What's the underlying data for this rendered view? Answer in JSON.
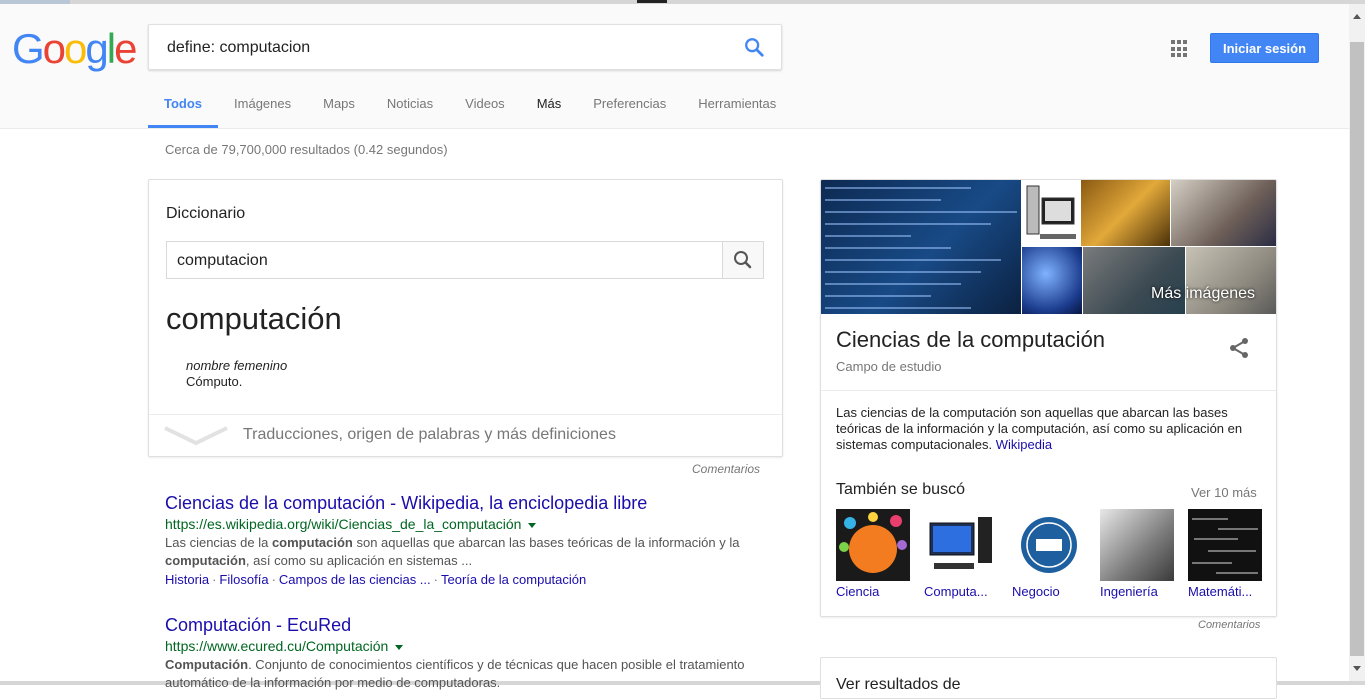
{
  "search": {
    "query": "define: computacion"
  },
  "logo": {
    "letters": [
      "G",
      "o",
      "o",
      "g",
      "l",
      "e"
    ],
    "colors": [
      "#4285f4",
      "#ea4335",
      "#fbbc05",
      "#4285f4",
      "#34a853",
      "#ea4335"
    ]
  },
  "header": {
    "signin_label": "Iniciar sesión",
    "tabs": [
      "Todos",
      "Imágenes",
      "Maps",
      "Noticias",
      "Videos",
      "Más",
      "Preferencias",
      "Herramientas"
    ]
  },
  "stats": "Cerca de 79,700,000 resultados (0.42 segundos)",
  "dictionary": {
    "title": "Diccionario",
    "input_value": "computacion",
    "word": "computación",
    "part_of_speech": "nombre femenino",
    "definition": "Cómputo.",
    "more_label": "Traducciones, origen de palabras y más definiciones",
    "feedback": "Comentarios"
  },
  "results": [
    {
      "title": "Ciencias de la computación - Wikipedia, la enciclopedia libre",
      "url": "https://es.wikipedia.org/wiki/Ciencias_de_la_computación",
      "snippet_parts": [
        "Las ciencias de la ",
        "computación",
        " son aquellas que abarcan las bases teóricas de la información y la ",
        "computación",
        ", así como su aplicación en sistemas ..."
      ],
      "links": [
        "Historia",
        "Filosofía",
        "Campos de las ciencias ...",
        "Teoría de la computación"
      ]
    },
    {
      "title": "Computación - EcuRed",
      "url": "https://www.ecured.cu/Computación",
      "snippet_parts": [
        "Computación",
        ". Conjunto de conocimientos científicos y de técnicas que hacen posible el tratamiento automático de la información por medio de computadoras."
      ]
    }
  ],
  "knowledge_panel": {
    "more_images": "Más imágenes",
    "title": "Ciencias de la computación",
    "subtitle": "Campo de estudio",
    "description": "Las ciencias de la computación son aquellas que abarcan las bases teóricas de la información y la computación, así como su aplicación en sistemas computacionales.",
    "source": "Wikipedia",
    "also_searched": "También se buscó",
    "see_more": "Ver 10 más",
    "items": [
      "Ciencia",
      "Computa...",
      "Negocio",
      "Ingeniería",
      "Matemáti..."
    ],
    "feedback": "Comentarios",
    "next_card_title": "Ver resultados de"
  }
}
